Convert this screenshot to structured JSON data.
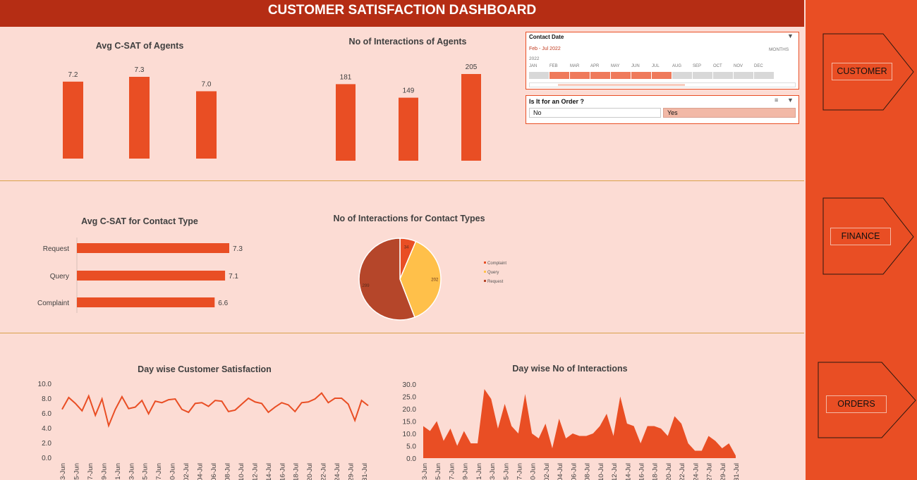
{
  "header": {
    "title": "CUSTOMER SATISFACTION DASHBOARD"
  },
  "nav": {
    "customer_label": "CUSTOMER",
    "finance_label": "FINANCE",
    "orders_label": "ORDERS"
  },
  "slicers": {
    "contact_date": {
      "title": "Contact Date",
      "range_label": "Feb - Jul 2022",
      "period_label": "MONTHS",
      "year_label": "2022",
      "months": [
        "JAN",
        "FEB",
        "MAR",
        "APR",
        "MAY",
        "JUN",
        "JUL",
        "AUG",
        "SEP",
        "OCT",
        "NOV",
        "DEC"
      ],
      "selected_months": [
        "FEB",
        "MAR",
        "APR",
        "MAY",
        "JUN",
        "JUL"
      ]
    },
    "order": {
      "title": "Is It for an Order ?",
      "options": [
        "No",
        "Yes"
      ],
      "selected": "Yes"
    }
  },
  "colors": {
    "accent": "#e94e24",
    "dark": "#b52d14",
    "background": "#fcdcd4",
    "query": "#ffc04a",
    "request": "#b5462a"
  },
  "chart_data": [
    {
      "id": "agents_csat",
      "type": "bar",
      "title": "Avg C-SAT of Agents",
      "categories": [
        "",
        "",
        ""
      ],
      "values": [
        7.2,
        7.3,
        7.0
      ],
      "labels": [
        "7.2",
        "7.3",
        "7.0"
      ]
    },
    {
      "id": "agents_interactions",
      "type": "bar",
      "title": "No of Interactions of Agents",
      "categories": [
        "",
        "",
        ""
      ],
      "values": [
        181,
        149,
        205
      ],
      "labels": [
        "181",
        "149",
        "205"
      ]
    },
    {
      "id": "contact_csat",
      "type": "bar",
      "orientation": "horizontal",
      "title": "Avg C-SAT for Contact Type",
      "categories": [
        "Request",
        "Query",
        "Complaint"
      ],
      "values": [
        7.3,
        7.1,
        6.6
      ],
      "labels": [
        "7.3",
        "7.1",
        "6.6"
      ]
    },
    {
      "id": "contact_interactions",
      "type": "pie",
      "title": "No of Interactions for Contact Types",
      "categories": [
        "Complaint",
        "Query",
        "Request"
      ],
      "values": [
        34,
        202,
        299
      ],
      "labels": [
        "34",
        "202",
        "299"
      ],
      "colors": [
        "#e94e24",
        "#ffc04a",
        "#b5462a"
      ],
      "legend": "right"
    },
    {
      "id": "day_csat",
      "type": "line",
      "title": "Day wise Customer Satisfaction",
      "ylim": [
        0,
        10
      ],
      "yticks": [
        "0.0",
        "2.0",
        "4.0",
        "6.0",
        "8.0",
        "10.0"
      ],
      "xtick_labels": [
        "3-Jun",
        "5-Jun",
        "7-Jun",
        "9-Jun",
        "1-Jun",
        "3-Jun",
        "5-Jun",
        "7-Jun",
        "0-Jun",
        "02-Jul",
        "04-Jul",
        "06-Jul",
        "08-Jul",
        "10-Jul",
        "12-Jul",
        "14-Jul",
        "16-Jul",
        "18-Jul",
        "20-Jul",
        "22-Jul",
        "24-Jul",
        "29-Jul",
        "31-Jul"
      ],
      "values": [
        6.5,
        8.1,
        7.3,
        6.3,
        8.3,
        5.7,
        7.9,
        4.3,
        6.5,
        8.2,
        6.6,
        6.8,
        7.7,
        5.9,
        7.6,
        7.4,
        7.8,
        7.9,
        6.5,
        6.1,
        7.3,
        7.4,
        6.9,
        7.7,
        7.6,
        6.2,
        6.4,
        7.2,
        8.0,
        7.5,
        7.3,
        6.1,
        6.8,
        7.4,
        7.1,
        6.2,
        7.4,
        7.5,
        7.9,
        8.7,
        7.4,
        8.0,
        8.0,
        7.2,
        5.0,
        7.7,
        7.0
      ]
    },
    {
      "id": "day_interactions",
      "type": "area",
      "title": "Day wise No of Interactions",
      "ylim": [
        0,
        30
      ],
      "yticks": [
        "0.0",
        "5.0",
        "10.0",
        "15.0",
        "20.0",
        "25.0",
        "30.0"
      ],
      "xtick_labels": [
        "3-Jun",
        "5-Jun",
        "7-Jun",
        "9-Jun",
        "1-Jun",
        "3-Jun",
        "5-Jun",
        "7-Jun",
        "0-Jun",
        "02-Jul",
        "04-Jul",
        "06-Jul",
        "08-Jul",
        "10-Jul",
        "12-Jul",
        "14-Jul",
        "16-Jul",
        "18-Jul",
        "20-Jul",
        "22-Jul",
        "24-Jul",
        "27-Jul",
        "29-Jul",
        "31-Jul"
      ],
      "values": [
        13,
        11,
        15,
        7,
        12,
        5,
        11,
        6,
        6,
        28,
        24,
        12,
        22,
        13,
        10,
        26,
        10,
        8,
        14,
        4,
        16,
        8,
        10,
        9,
        9,
        10,
        13,
        18,
        9,
        25,
        14,
        13,
        6,
        13,
        13,
        12,
        9,
        17,
        14,
        6,
        3,
        3,
        9,
        7,
        4,
        6,
        1
      ]
    }
  ]
}
